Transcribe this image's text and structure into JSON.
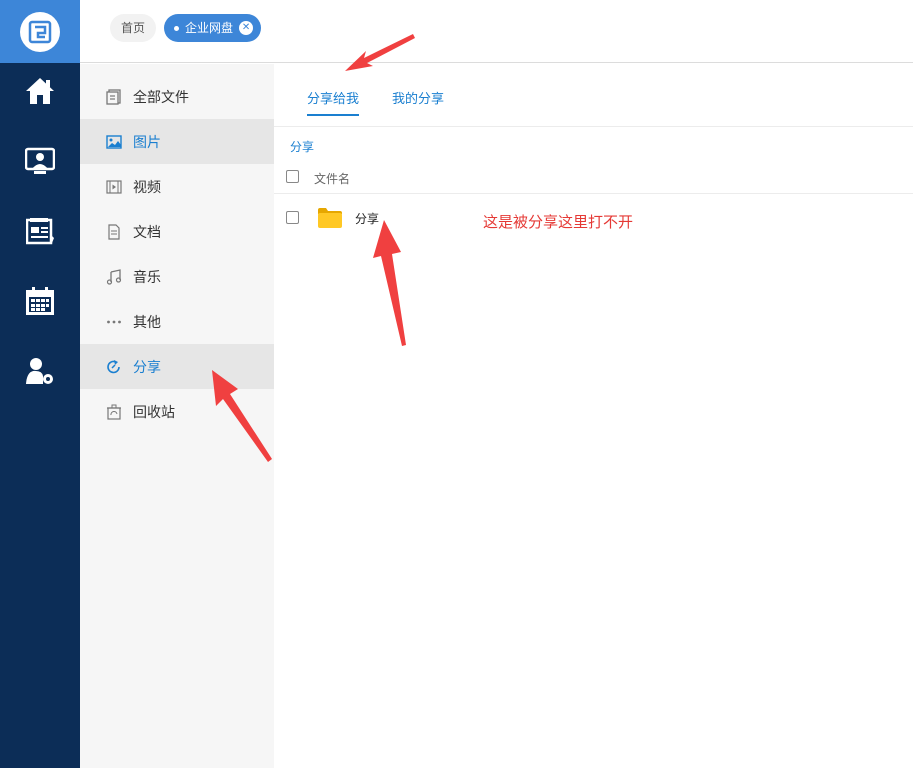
{
  "topbar": {
    "home_tab": "首页",
    "active_tab": "企业网盘",
    "close_symbol": "✕"
  },
  "sidebar_icons": [
    "home-icon",
    "monitor-user-icon",
    "news-icon",
    "calendar-icon",
    "user-settings-icon"
  ],
  "subnav": {
    "items": [
      {
        "label": "全部文件",
        "icon": "file-list-icon",
        "active": false
      },
      {
        "label": "图片",
        "icon": "image-icon",
        "active": true
      },
      {
        "label": "视频",
        "icon": "video-icon",
        "active": false
      },
      {
        "label": "文档",
        "icon": "document-icon",
        "active": false
      },
      {
        "label": "音乐",
        "icon": "music-icon",
        "active": false
      },
      {
        "label": "其他",
        "icon": "more-icon",
        "active": false
      },
      {
        "label": "分享",
        "icon": "share-icon",
        "active": true
      },
      {
        "label": "回收站",
        "icon": "recycle-icon",
        "active": false
      }
    ]
  },
  "content": {
    "tabs": [
      {
        "label": "分享给我",
        "active": true
      },
      {
        "label": "我的分享",
        "active": false
      }
    ],
    "breadcrumb": "分享",
    "column_filename": "文件名",
    "files": [
      {
        "name": "分享",
        "icon": "folder-icon"
      }
    ]
  },
  "annotation": {
    "text": "这是被分享这里打不开",
    "color": "#e53935"
  },
  "colors": {
    "rail": "#0c2d57",
    "logo_bg": "#3d86d8",
    "accent": "#1a7fd0",
    "arrow": "#f04040"
  }
}
